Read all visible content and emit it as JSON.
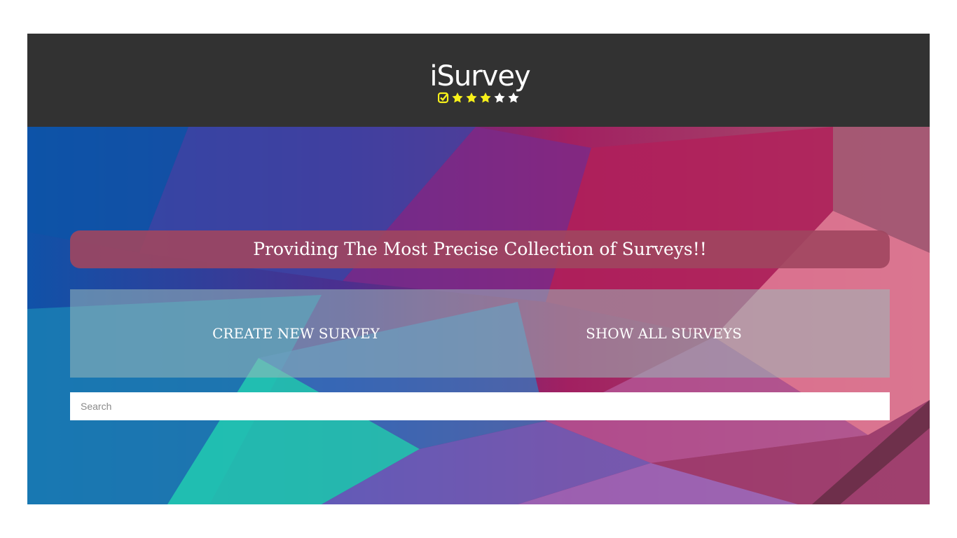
{
  "header": {
    "logo_text": "iSurvey",
    "stars": [
      "check",
      "filled",
      "filled",
      "filled",
      "empty",
      "empty"
    ],
    "colors": {
      "background": "#323232",
      "star_filled": "#f7f01a",
      "star_empty": "#ffffff"
    }
  },
  "hero": {
    "tagline": "Providing The Most Precise Collection of Surveys!!"
  },
  "actions": {
    "create_label": "CREATE NEW SURVEY",
    "show_label": "SHOW ALL SURVEYS"
  },
  "search": {
    "placeholder": "Search",
    "value": ""
  }
}
